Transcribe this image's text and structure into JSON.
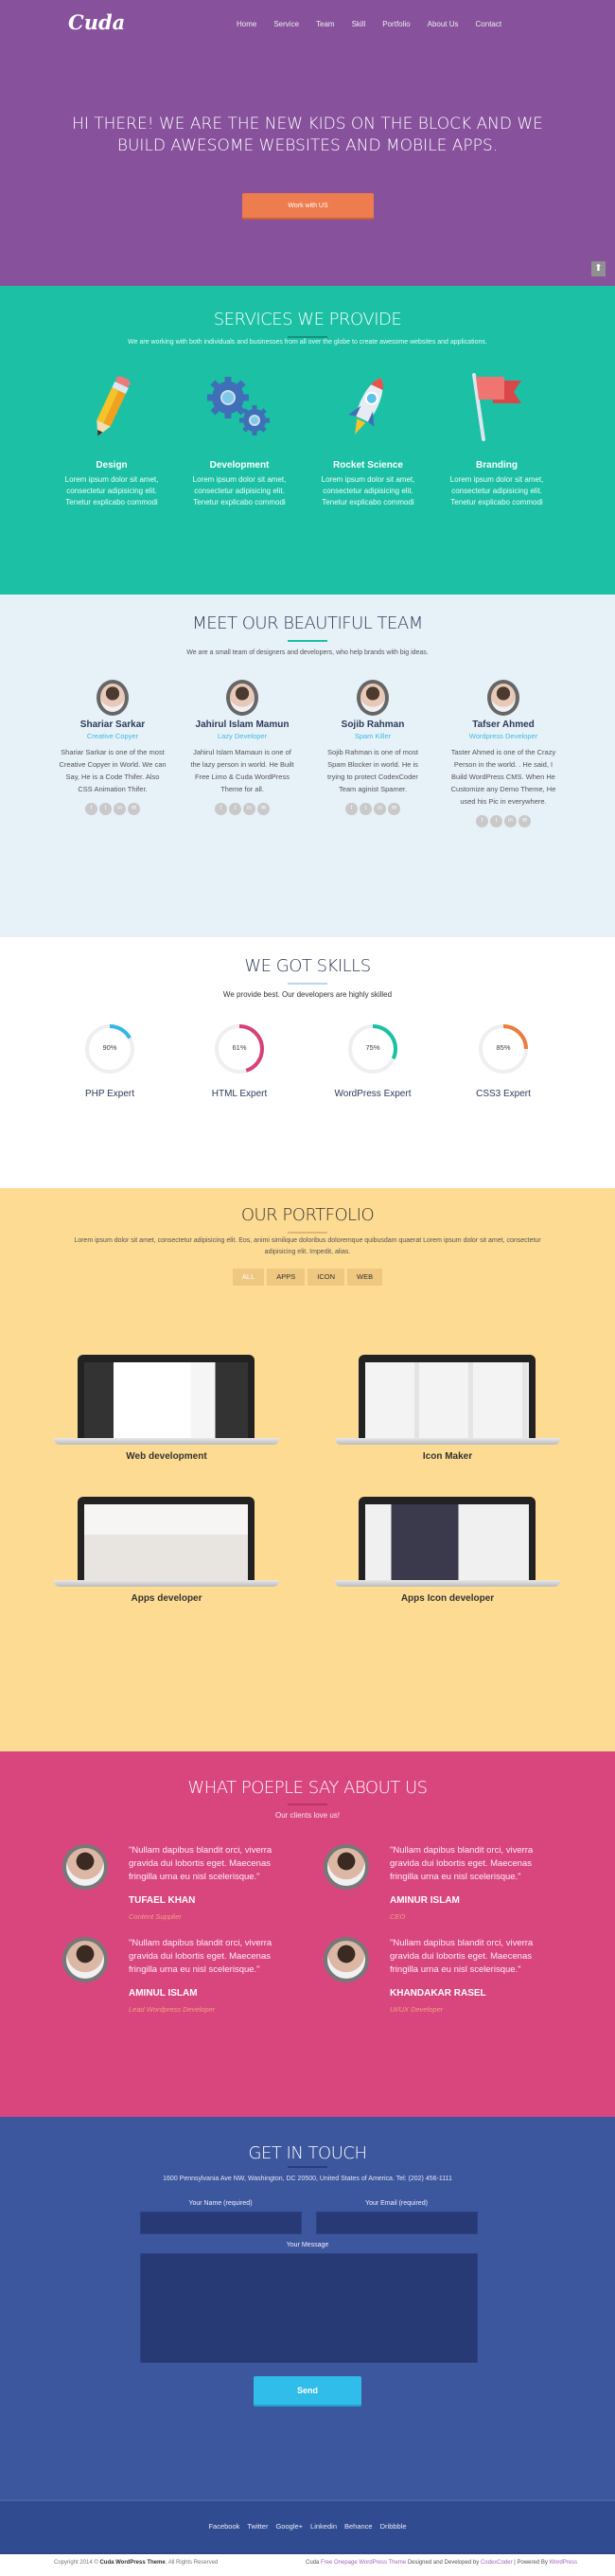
{
  "header": {
    "logo": "Cuda",
    "nav": [
      "Home",
      "Service",
      "Team",
      "Skill",
      "Portfolio",
      "About Us",
      "Contact"
    ]
  },
  "hero": {
    "title_line1": "HI THERE! WE ARE THE NEW KIDS ON THE BLOCK AND WE",
    "title_line2": "BUILD AWESOME WEBSITES AND MOBILE APPS.",
    "button": "Work with US",
    "scroll_top_icon": "arrow-up-icon"
  },
  "services": {
    "title": "SERVICES WE PROVIDE",
    "subtitle": "We are working with both individuals and businesses from all over the globe to create awesome websites and applications.",
    "items": [
      {
        "icon": "pencil-icon",
        "title": "Design",
        "text": "Lorem ipsum dolor sit amet, consectetur adipisicing elit. Tenetur explicabo commodi"
      },
      {
        "icon": "gears-icon",
        "title": "Development",
        "text": "Lorem ipsum dolor sit amet, consectetur adipisicing elit. Tenetur explicabo commodi"
      },
      {
        "icon": "rocket-icon",
        "title": "Rocket Science",
        "text": "Lorem ipsum dolor sit amet, consectetur adipisicing elit. Tenetur explicabo commodi"
      },
      {
        "icon": "flag-icon",
        "title": "Branding",
        "text": "Lorem ipsum dolor sit amet, consectetur adipisicing elit. Tenetur explicabo commodi"
      }
    ]
  },
  "team": {
    "title": "MEET OUR BEAUTIFUL TEAM",
    "subtitle": "We are a small team of designers and developers, who help brands with big ideas.",
    "members": [
      {
        "name": "Shariar Sarkar",
        "role": "Creative Copyer",
        "bio": "Shariar Sarkar is one of the most Creative Copyer in World. We can Say, He is a  Code Thifer.  Also CSS Animation Thifer."
      },
      {
        "name": "Jahirul Islam Mamun",
        "role": "Lazy Developer",
        "bio": "Jahirul Islam Mamaun is one of the lazy person in world. He Built Free Limo & Cuda WordPress Theme for all."
      },
      {
        "name": "Sojib Rahman",
        "role": "Spam Killer",
        "bio": "Sojib Rahman is one of most Spam Blocker in world. He is trying to protect CodexCoder Team aginist Spamer."
      },
      {
        "name": "Tafser Ahmed",
        "role": "Wordpress Developer",
        "bio": "Taster Ahmed is one of the Crazy Person in the world. . He said, I Build WordPress CMS. When He Customize any Demo Theme, He used his Pic in everywhere."
      }
    ],
    "social_glyphs": [
      "f",
      "t",
      "in",
      "✉"
    ]
  },
  "skills": {
    "title": "WE GOT SKILLS",
    "subtitle": "We provide best. Our developers are highly skilled",
    "items": [
      {
        "label": "PHP Expert",
        "percent_text": "90%",
        "arc_fraction": 0.17,
        "color": "#35b6e6"
      },
      {
        "label": "HTML Expert",
        "percent_text": "61%",
        "arc_fraction": 0.45,
        "color": "#d8407a"
      },
      {
        "label": "WordPress Expert",
        "percent_text": "75%",
        "arc_fraction": 0.32,
        "color": "#1bc0a5"
      },
      {
        "label": "CSS3 Expert",
        "percent_text": "85%",
        "arc_fraction": 0.25,
        "color": "#ed7c3e"
      }
    ]
  },
  "portfolio": {
    "title": "OUR PORTFOLIO",
    "subtitle": "Lorem ipsum dolor sit amet, consectetur adipisicing elit. Eos, animi similique doloribus doloremque quibusdam quaerat Lorem ipsum dolor sit amet, consectetur adipisicing elit. Impedit, alias.",
    "filters": [
      "ALL",
      "APPS",
      "ICON",
      "WEB"
    ],
    "active_filter": "ALL",
    "works": [
      {
        "title": "Web development"
      },
      {
        "title": "Icon Maker"
      },
      {
        "title": "Apps developer"
      },
      {
        "title": "Apps Icon developer"
      }
    ]
  },
  "testimonials": {
    "title": "WHAT POEPLE SAY ABOUT US",
    "subtitle": "Our clients love us!",
    "items": [
      {
        "quote": "\"Nullam dapibus blandit orci, viverra gravida dui lobortis eget. Maecenas fringilla urna eu nisl scelerisque.\"",
        "name": "TUFAEL KHAN",
        "role": "Content Supplier"
      },
      {
        "quote": "\"Nullam dapibus blandit orci, viverra gravida dui lobortis eget. Maecenas fringilla urna eu nisl scelerisque.\"",
        "name": "AMINUR ISLAM",
        "role": "CEO"
      },
      {
        "quote": "\"Nullam dapibus blandit orci, viverra gravida dui lobortis eget. Maecenas fringilla urna eu nisl scelerisque.\"",
        "name": "AMINUL ISLAM",
        "role": "Lead Wordpress Developer"
      },
      {
        "quote": "\"Nullam dapibus blandit orci, viverra gravida dui lobortis eget. Maecenas fringilla urna eu nisl scelerisque.\"",
        "name": "KHANDAKAR RASEL",
        "role": "UI/UX Developer"
      }
    ]
  },
  "contact": {
    "title": "GET IN TOUCH",
    "address": "1600 Pennsylvania Ave NW, Washington, DC 20500, United States of America. Tel: (202) 456-1111",
    "name_label": "Your Name (required)",
    "email_label": "Your Email (required)",
    "message_label": "Your Message",
    "name_value": "",
    "email_value": "",
    "message_value": "",
    "send": "Send"
  },
  "footer": {
    "social_links": [
      "Facebook",
      "Twitter",
      "Google+",
      "Linkedin",
      "Behance",
      "Dribbble"
    ],
    "copyright_prefix": "Copyright 2014 © ",
    "copyright_brand": "Cuda WordPress Theme",
    "copyright_suffix": ", All Rights Reserved",
    "credit_prefix": "Cuda ",
    "credit_link1": "Free Onepage WordPress Theme",
    "credit_mid": " Designed and Developed by ",
    "credit_link2": "CodexCoder",
    "credit_sep": " | Powered By ",
    "credit_link3": "WordPress"
  }
}
